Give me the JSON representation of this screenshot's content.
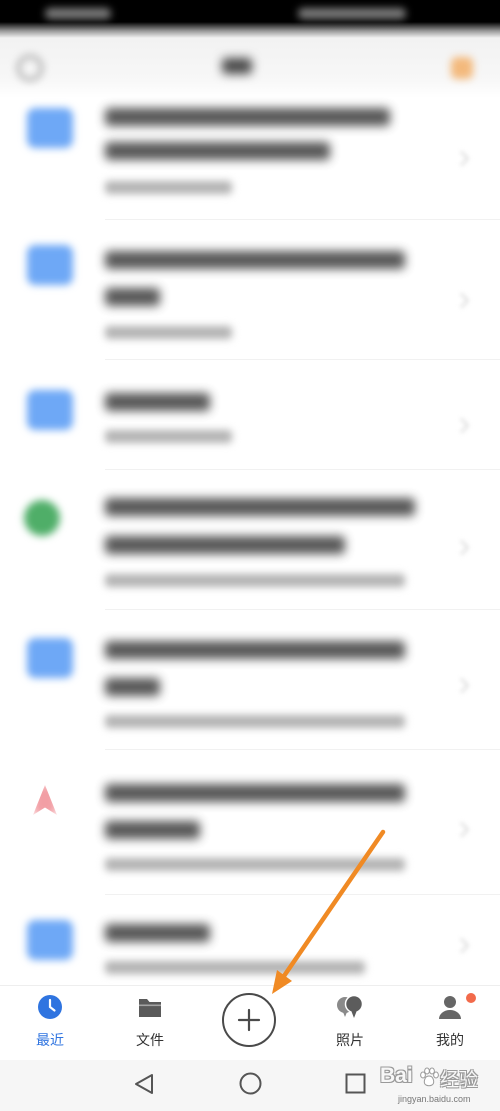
{
  "status_bar": {
    "background": "#000000"
  },
  "header": {
    "left_icon": "circle-icon",
    "right_icon": "avatar-icon",
    "right_icon_color": "#f3b97c"
  },
  "list": {
    "items": [
      {
        "icon": "folder-icon",
        "icon_color": "#6ea8f6"
      },
      {
        "icon": "folder-icon",
        "icon_color": "#6ea8f6"
      },
      {
        "icon": "folder-icon",
        "icon_color": "#6ea8f6"
      },
      {
        "icon": "green-file-icon",
        "icon_color": "#4fae68"
      },
      {
        "icon": "folder-icon",
        "icon_color": "#6ea8f6"
      },
      {
        "icon": "pdf-icon",
        "icon_color": "#f29ea4"
      },
      {
        "icon": "folder-icon",
        "icon_color": "#6ea8f6"
      }
    ]
  },
  "bottom_nav": {
    "items": [
      {
        "label": "最近",
        "icon": "clock-icon",
        "active": true
      },
      {
        "label": "文件",
        "icon": "folder-icon",
        "active": false
      },
      {
        "label": "照片",
        "icon": "photos-icon",
        "active": false
      },
      {
        "label": "我的",
        "icon": "profile-icon",
        "active": false,
        "badge_dot": true
      }
    ],
    "add_button": {
      "icon": "plus-icon"
    },
    "active_color": "#2f74e0",
    "inactive_color": "#333333",
    "badge_color": "#f26a4b"
  },
  "system_nav": {
    "back_icon": "back-triangle-icon",
    "home_icon": "home-circle-icon",
    "recents_icon": "recents-square-icon"
  },
  "annotation": {
    "arrow_color": "#f08a24"
  },
  "watermark": {
    "brand_latin": "Bai",
    "brand_cn": "经验",
    "url": "jingyan.baidu.com"
  }
}
